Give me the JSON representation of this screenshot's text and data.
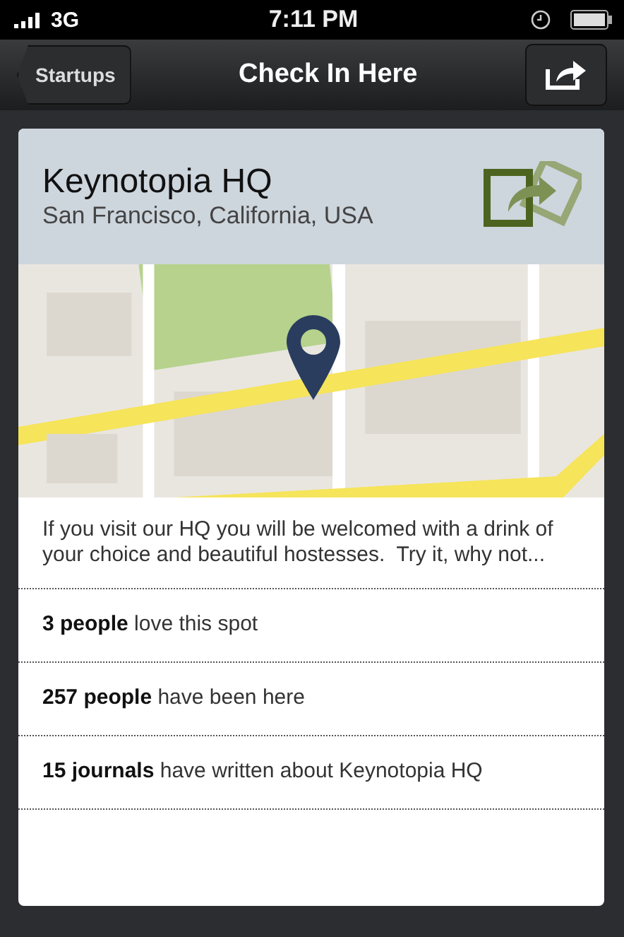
{
  "status_bar": {
    "carrier": "3G",
    "time": "7:11 PM"
  },
  "nav_bar": {
    "back_button": "Startups",
    "title": "Check In Here"
  },
  "place": {
    "name": "Keynotopia HQ",
    "location": "San Francisco, California, USA",
    "description": "If you visit our HQ you will be welcomed with a drink of your choice and beautiful hostesses.  Try it, why not..."
  },
  "stats": [
    {
      "text": "**3 people** love this spot"
    },
    {
      "text": "**257 people** have been here"
    },
    {
      "text": "**15 journals** have written about Keynotopia HQ"
    }
  ]
}
